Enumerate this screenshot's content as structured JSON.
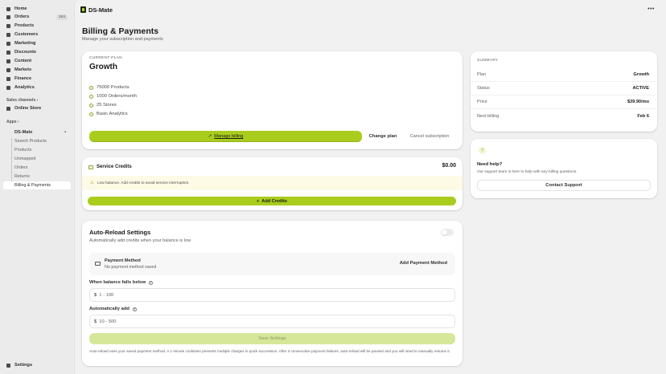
{
  "sidebar": {
    "items": [
      {
        "label": "Home",
        "icon": "home-icon"
      },
      {
        "label": "Orders",
        "icon": "orders-icon",
        "badge": "184"
      },
      {
        "label": "Products",
        "icon": "tag-icon"
      },
      {
        "label": "Customers",
        "icon": "person-icon"
      },
      {
        "label": "Marketing",
        "icon": "target-icon"
      },
      {
        "label": "Discounts",
        "icon": "discount-icon"
      },
      {
        "label": "Content",
        "icon": "content-icon"
      },
      {
        "label": "Markets",
        "icon": "globe-icon"
      },
      {
        "label": "Finance",
        "icon": "bank-icon"
      },
      {
        "label": "Analytics",
        "icon": "chart-icon"
      }
    ],
    "sales_channels_label": "Sales channels",
    "online_store": "Online Store",
    "apps_label": "Apps",
    "app_name": "DS-Mate",
    "app_sub_items": [
      "Search Products",
      "Products",
      "Unmapped",
      "Orders",
      "Returns",
      "Billing & Payments"
    ],
    "settings": "Settings"
  },
  "topbar": {
    "app_title": "DS-Mate",
    "more": "•••"
  },
  "page": {
    "title": "Billing & Payments",
    "subtitle": "Manage your subscription and payments"
  },
  "plan": {
    "current_label": "CURRENT PLAN",
    "name": "Growth",
    "features": [
      "75000 Products",
      "1000 Orders/month",
      "25 Stores",
      "Basic Analytics"
    ],
    "manage_billing": "Manage billing",
    "change_plan": "Change plan",
    "cancel": "Cancel subscription"
  },
  "credits": {
    "title": "Service Credits",
    "balance": "$0.00",
    "warning": "Low balance. Add credits to avoid service interruption.",
    "add_button": "Add Credits"
  },
  "auto_reload": {
    "title": "Auto-Reload Settings",
    "subtitle": "Automatically add credits when your balance is low",
    "payment_method_title": "Payment Method",
    "payment_method_status": "No payment method saved",
    "add_payment": "Add Payment Method",
    "threshold_label": "When balance falls below",
    "threshold_currency": "$",
    "threshold_placeholder": "1 - 100",
    "amount_label": "Automatically add",
    "amount_currency": "$",
    "amount_placeholder": "10 - 500",
    "save": "Save Settings",
    "footnote": "Auto-reload uses your saved payment method. A 1-minute cooldown prevents multiple charges in quick succession. After 3 consecutive payment failures, auto-reload will be paused and you will need to manually resume it."
  },
  "summary": {
    "title": "SUMMARY",
    "rows": [
      {
        "key": "Plan",
        "value": "Growth"
      },
      {
        "key": "Status",
        "value": "ACTIVE"
      },
      {
        "key": "Price",
        "value": "$39.90/mo"
      },
      {
        "key": "Next billing",
        "value": "Feb 6"
      }
    ]
  },
  "help": {
    "title": "Need help?",
    "text": "Our support team is here to help with any billing questions.",
    "button": "Contact Support"
  },
  "colors": {
    "accent": "#a9cc1d",
    "accent_disabled": "#d6e79a",
    "warning_bg": "#fdfbe6"
  }
}
